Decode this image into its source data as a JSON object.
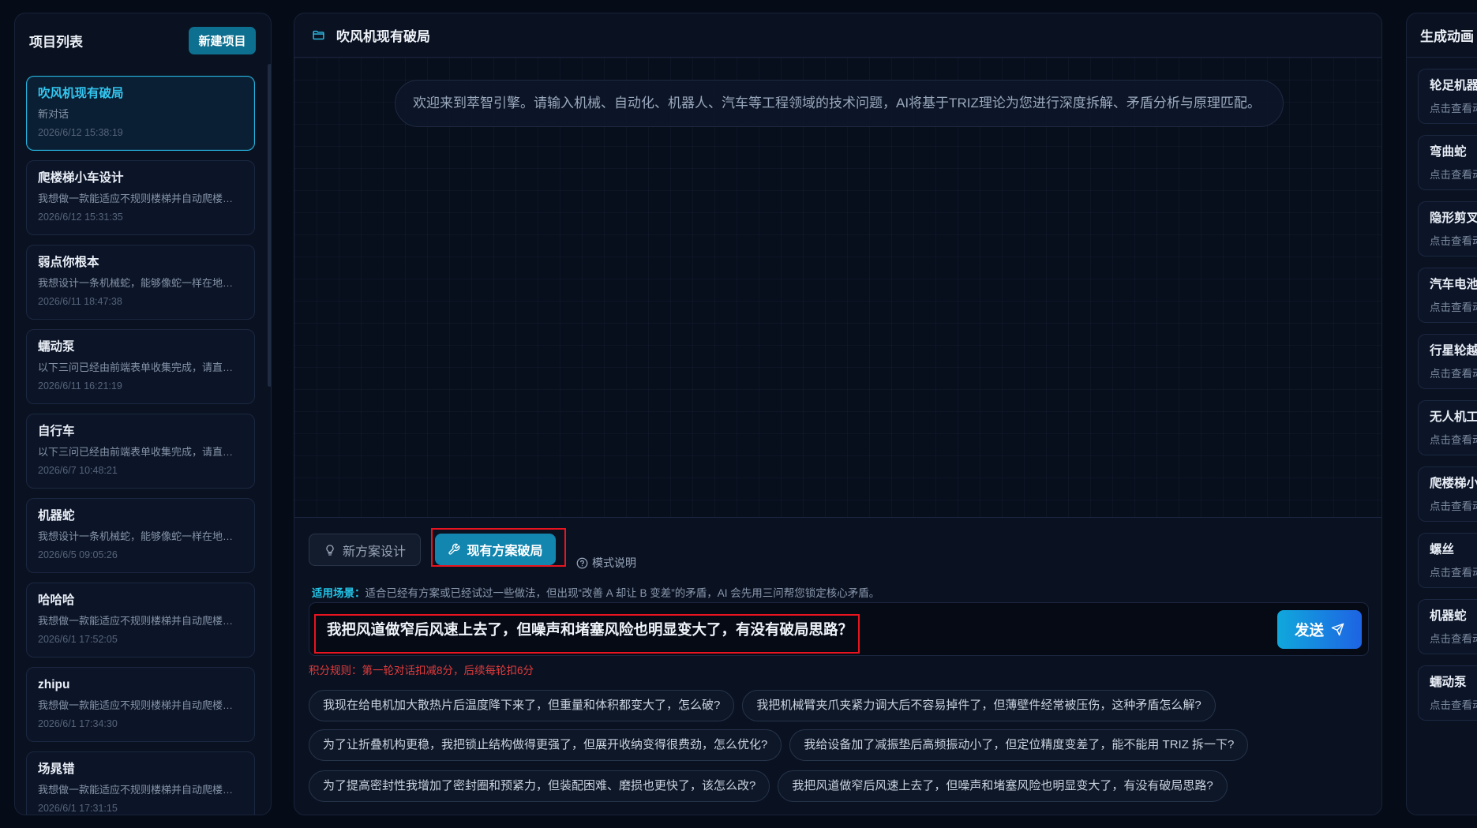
{
  "theme": {
    "background": "#050b17",
    "panel": "#0a1222",
    "accent": "#21b8e3",
    "active_mode": "#1386b0",
    "highlight": "#e8141f",
    "danger": "#e23b3b",
    "send_gradient": [
      "#10a8dc",
      "#1e63e3"
    ]
  },
  "sidebar": {
    "title": "项目列表",
    "new_button_label": "新建项目",
    "projects": [
      {
        "title": "吹风机现有破局",
        "subtitle": "新对话",
        "date": "2026/6/12 15:38:19",
        "selected": true
      },
      {
        "title": "爬楼梯小车设计",
        "subtitle": "我想做一款能适应不规则楼梯并自动爬楼…",
        "date": "2026/6/12 15:31:35",
        "selected": false
      },
      {
        "title": "弱点你根本",
        "subtitle": "我想设计一条机械蛇，能够像蛇一样在地…",
        "date": "2026/6/11 18:47:38",
        "selected": false
      },
      {
        "title": "蠕动泵",
        "subtitle": "以下三问已经由前端表单收集完成，请直…",
        "date": "2026/6/11 16:21:19",
        "selected": false
      },
      {
        "title": "自行车",
        "subtitle": "以下三问已经由前端表单收集完成，请直…",
        "date": "2026/6/7 10:48:21",
        "selected": false
      },
      {
        "title": "机器蛇",
        "subtitle": "我想设计一条机械蛇，能够像蛇一样在地…",
        "date": "2026/6/5 09:05:26",
        "selected": false
      },
      {
        "title": "哈哈哈",
        "subtitle": "我想做一款能适应不规则楼梯并自动爬楼…",
        "date": "2026/6/1 17:52:05",
        "selected": false
      },
      {
        "title": "zhipu",
        "subtitle": "我想做一款能适应不规则楼梯并自动爬楼…",
        "date": "2026/6/1 17:34:30",
        "selected": false
      },
      {
        "title": "场晁错",
        "subtitle": "我想做一款能适应不规则楼梯并自动爬楼…",
        "date": "2026/6/1 17:31:15",
        "selected": false
      }
    ]
  },
  "conversation": {
    "icon": "folder-icon",
    "title": "吹风机现有破局",
    "welcome_message": "欢迎来到萃智引擎。请输入机械、自动化、机器人、汽车等工程领域的技术问题，AI将基于TRIZ理论为您进行深度拆解、矛盾分析与原理匹配。"
  },
  "modes": {
    "items": [
      {
        "label": "新方案设计",
        "icon": "lightbulb-icon",
        "active": false
      },
      {
        "label": "现有方案破局",
        "icon": "wrench-icon",
        "active": true
      }
    ],
    "help_label": "模式说明",
    "help_icon": "question-circle-icon"
  },
  "scene": {
    "label": "适用场景：",
    "text": "适合已经有方案或已经试过一些做法，但出现“改善 A 却让 B 变差”的矛盾，AI 会先用三问帮您锁定核心矛盾。"
  },
  "composer": {
    "value": "我把风道做窄后风速上去了，但噪声和堵塞风险也明显变大了，有没有破局思路？",
    "send_label": "发送",
    "send_icon": "paper-plane-icon"
  },
  "points_rule": "积分规则：第一轮对话扣减8分，后续每轮扣6分",
  "suggestions": [
    "我现在给电机加大散热片后温度降下来了，但重量和体积都变大了，怎么破?",
    "我把机械臂夹爪夹紧力调大后不容易掉件了，但薄壁件经常被压伤，这种矛盾怎么解?",
    "为了让折叠机构更稳，我把锁止结构做得更强了，但展开收纳变得很费劲，怎么优化?",
    "我给设备加了减振垫后高频振动小了，但定位精度变差了，能不能用 TRIZ 拆一下?",
    "为了提高密封性我增加了密封圈和预紧力，但装配困难、磨损也更快了，该怎么改?",
    "我把风道做窄后风速上去了，但噪声和堵塞风险也明显变大了，有没有破局思路?"
  ],
  "animations": {
    "title": "生成动画",
    "items": [
      {
        "title": "轮足机器",
        "subtitle": "点击查看动"
      },
      {
        "title": "弯曲蛇",
        "subtitle": "点击查看动"
      },
      {
        "title": "隐形剪叉",
        "subtitle": "点击查看动"
      },
      {
        "title": "汽车电池",
        "subtitle": "点击查看动"
      },
      {
        "title": "行星轮越",
        "subtitle": "点击查看动"
      },
      {
        "title": "无人机工",
        "subtitle": "点击查看动"
      },
      {
        "title": "爬楼梯小",
        "subtitle": "点击查看动"
      },
      {
        "title": "螺丝",
        "subtitle": "点击查看动"
      },
      {
        "title": "机器蛇",
        "subtitle": "点击查看动"
      },
      {
        "title": "蠕动泵",
        "subtitle": "点击查看动"
      }
    ]
  }
}
